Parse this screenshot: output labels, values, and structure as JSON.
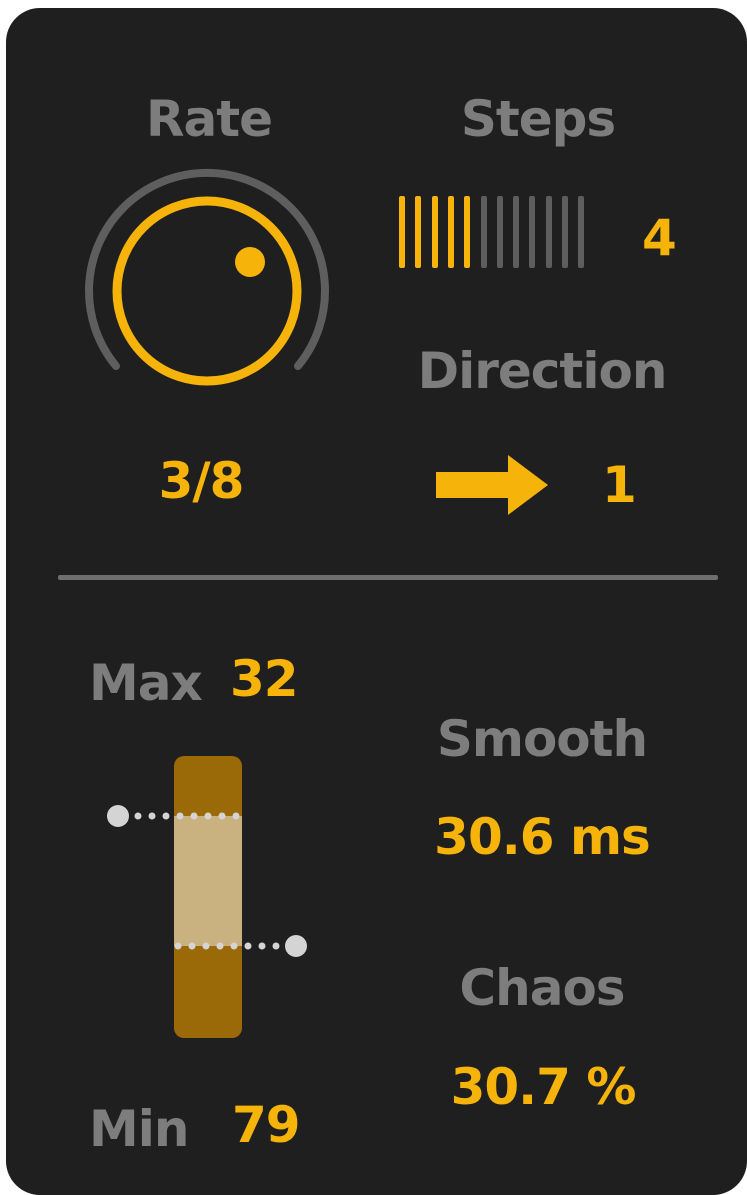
{
  "rate": {
    "label": "Rate",
    "value": "3/8",
    "knob_level": 0.72
  },
  "steps": {
    "label": "Steps",
    "value": "4",
    "total": 12,
    "active": 5
  },
  "direction": {
    "label": "Direction",
    "value": "1",
    "icon": "arrow-right-icon"
  },
  "range": {
    "max_label": "Max",
    "max_value": "32",
    "min_label": "Min",
    "min_value": "79"
  },
  "smooth": {
    "label": "Smooth",
    "value": "30.6 ms"
  },
  "chaos": {
    "label": "Chaos",
    "value": "30.7 %"
  },
  "colors": {
    "accent": "#f6b40a",
    "label": "#7d7d7d",
    "background": "#1f1f1f",
    "inactive": "#5e5e5e",
    "range_dark": "#9a6a08",
    "range_light": "#c9b280",
    "handle": "#d4d4d4"
  }
}
